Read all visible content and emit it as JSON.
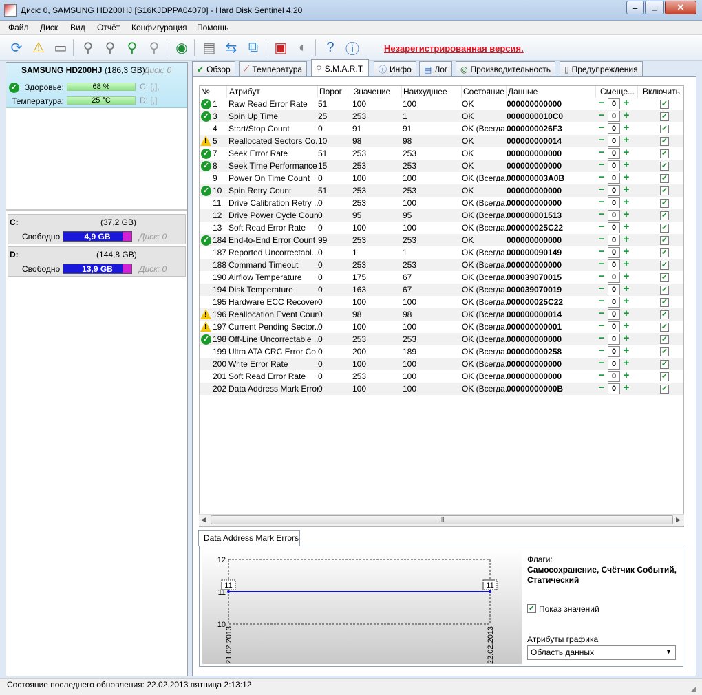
{
  "window": {
    "title": "Диск: 0, SAMSUNG HD200HJ [S16KJDPPA04070]  -  Hard Disk Sentinel 4.20",
    "min": "–",
    "max": "□",
    "close": "✕"
  },
  "menu": [
    "Файл",
    "Диск",
    "Вид",
    "Отчёт",
    "Конфигурация",
    "Помощь"
  ],
  "toolbar": {
    "unregistered": "Незарегистрированная версия."
  },
  "disk": {
    "name": "SAMSUNG HD200HJ",
    "size": "(186,3 GB)",
    "disk_label": "Диск: 0",
    "health_label": "Здоровье:",
    "health_value": "68 %",
    "health_percent": 68,
    "health_drive": "C: [,],",
    "temp_label": "Температура:",
    "temp_value": "25 °C",
    "temp_drive": "D: [,]"
  },
  "drives": [
    {
      "letter": "C:",
      "size": "(37,2 GB)",
      "free_label": "Свободно",
      "free": "4,9 GB",
      "disk": "Диск: 0",
      "free_fraction": 0.13
    },
    {
      "letter": "D:",
      "size": "(144,8 GB)",
      "free_label": "Свободно",
      "free": "13,9 GB",
      "disk": "Диск: 0",
      "free_fraction": 0.1
    }
  ],
  "tabs": [
    "Обзор",
    "Температура",
    "S.M.A.R.T.",
    "Инфо",
    "Лог",
    "Производительность",
    "Предупреждения"
  ],
  "columns": [
    "№",
    "Атрибут",
    "Порог",
    "Значение",
    "Наихудшее",
    "Состояние",
    "Данные",
    "Смеще...",
    "Включить"
  ],
  "rows": [
    {
      "icon": "ok",
      "no": "1",
      "attr": "Raw Read Error Rate",
      "thr": "51",
      "val": "100",
      "worst": "100",
      "state": "OK",
      "data": "000000000000"
    },
    {
      "icon": "ok",
      "no": "3",
      "attr": "Spin Up Time",
      "thr": "25",
      "val": "253",
      "worst": "1",
      "state": "OK",
      "data": "0000000010C0"
    },
    {
      "icon": "",
      "no": "4",
      "attr": "Start/Stop Count",
      "thr": "0",
      "val": "91",
      "worst": "91",
      "state": "OK (Всегда...",
      "data": "0000000026F3"
    },
    {
      "icon": "warn",
      "no": "5",
      "attr": "Reallocated Sectors Co...",
      "thr": "10",
      "val": "98",
      "worst": "98",
      "state": "OK",
      "data": "000000000014"
    },
    {
      "icon": "ok",
      "no": "7",
      "attr": "Seek Error Rate",
      "thr": "51",
      "val": "253",
      "worst": "253",
      "state": "OK",
      "data": "000000000000"
    },
    {
      "icon": "ok",
      "no": "8",
      "attr": "Seek Time Performance",
      "thr": "15",
      "val": "253",
      "worst": "253",
      "state": "OK",
      "data": "000000000000"
    },
    {
      "icon": "",
      "no": "9",
      "attr": "Power On Time Count",
      "thr": "0",
      "val": "100",
      "worst": "100",
      "state": "OK (Всегда...",
      "data": "000000003A0B"
    },
    {
      "icon": "ok",
      "no": "10",
      "attr": "Spin Retry Count",
      "thr": "51",
      "val": "253",
      "worst": "253",
      "state": "OK",
      "data": "000000000000"
    },
    {
      "icon": "",
      "no": "11",
      "attr": "Drive Calibration Retry ...",
      "thr": "0",
      "val": "253",
      "worst": "100",
      "state": "OK (Всегда...",
      "data": "000000000000"
    },
    {
      "icon": "",
      "no": "12",
      "attr": "Drive Power Cycle Count",
      "thr": "0",
      "val": "95",
      "worst": "95",
      "state": "OK (Всегда...",
      "data": "000000001513"
    },
    {
      "icon": "",
      "no": "13",
      "attr": "Soft Read Error Rate",
      "thr": "0",
      "val": "100",
      "worst": "100",
      "state": "OK (Всегда...",
      "data": "000000025C22"
    },
    {
      "icon": "ok",
      "no": "184",
      "attr": "End-to-End Error Count",
      "thr": "99",
      "val": "253",
      "worst": "253",
      "state": "OK",
      "data": "000000000000"
    },
    {
      "icon": "",
      "no": "187",
      "attr": "Reported Uncorrectabl...",
      "thr": "0",
      "val": "1",
      "worst": "1",
      "state": "OK (Всегда...",
      "data": "000000090149"
    },
    {
      "icon": "",
      "no": "188",
      "attr": "Command Timeout",
      "thr": "0",
      "val": "253",
      "worst": "253",
      "state": "OK (Всегда...",
      "data": "000000000000"
    },
    {
      "icon": "",
      "no": "190",
      "attr": "Airflow Temperature",
      "thr": "0",
      "val": "175",
      "worst": "67",
      "state": "OK (Всегда...",
      "data": "000039070015"
    },
    {
      "icon": "",
      "no": "194",
      "attr": "Disk Temperature",
      "thr": "0",
      "val": "163",
      "worst": "67",
      "state": "OK (Всегда...",
      "data": "000039070019"
    },
    {
      "icon": "",
      "no": "195",
      "attr": "Hardware ECC Recovered",
      "thr": "0",
      "val": "100",
      "worst": "100",
      "state": "OK (Всегда...",
      "data": "000000025C22"
    },
    {
      "icon": "warn",
      "no": "196",
      "attr": "Reallocation Event Count",
      "thr": "0",
      "val": "98",
      "worst": "98",
      "state": "OK (Всегда...",
      "data": "000000000014"
    },
    {
      "icon": "warn",
      "no": "197",
      "attr": "Current Pending Sector...",
      "thr": "0",
      "val": "100",
      "worst": "100",
      "state": "OK (Всегда...",
      "data": "000000000001"
    },
    {
      "icon": "ok",
      "no": "198",
      "attr": "Off-Line Uncorrectable ...",
      "thr": "0",
      "val": "253",
      "worst": "253",
      "state": "OK (Всегда...",
      "data": "000000000000"
    },
    {
      "icon": "",
      "no": "199",
      "attr": "Ultra ATA CRC Error Co...",
      "thr": "0",
      "val": "200",
      "worst": "189",
      "state": "OK (Всегда...",
      "data": "000000000258"
    },
    {
      "icon": "",
      "no": "200",
      "attr": "Write Error Rate",
      "thr": "0",
      "val": "100",
      "worst": "100",
      "state": "OK (Всегда...",
      "data": "000000000000"
    },
    {
      "icon": "",
      "no": "201",
      "attr": "Soft Read Error Rate",
      "thr": "0",
      "val": "253",
      "worst": "100",
      "state": "OK (Всегда...",
      "data": "000000000000"
    },
    {
      "icon": "",
      "no": "202",
      "attr": "Data Address Mark Errors",
      "thr": "0",
      "val": "100",
      "worst": "100",
      "state": "OK (Всегда...",
      "data": "00000000000B"
    }
  ],
  "offset_value": "0",
  "scroll_grip": "III",
  "bottom": {
    "tab": "Data Address Mark Errors",
    "flags_label": "Флаги:",
    "flags_value": "Самосохранение, Счётчик Событий, Статический",
    "show_values": "Показ значений",
    "graph_attr_label": "Атрибуты графика",
    "graph_attr_value": "Область данных"
  },
  "chart_data": {
    "type": "line",
    "x": [
      "21.02.2013",
      "22.02.2013"
    ],
    "series": [
      {
        "values": [
          11,
          11
        ]
      }
    ],
    "ylim": [
      10,
      12
    ],
    "yticks": [
      "12",
      "11",
      "10"
    ],
    "point_labels": [
      "11",
      "11"
    ],
    "color": "#1010c8"
  },
  "status": {
    "text": "Состояние последнего обновления: 22.02.2013 пятница 2:13:12"
  }
}
